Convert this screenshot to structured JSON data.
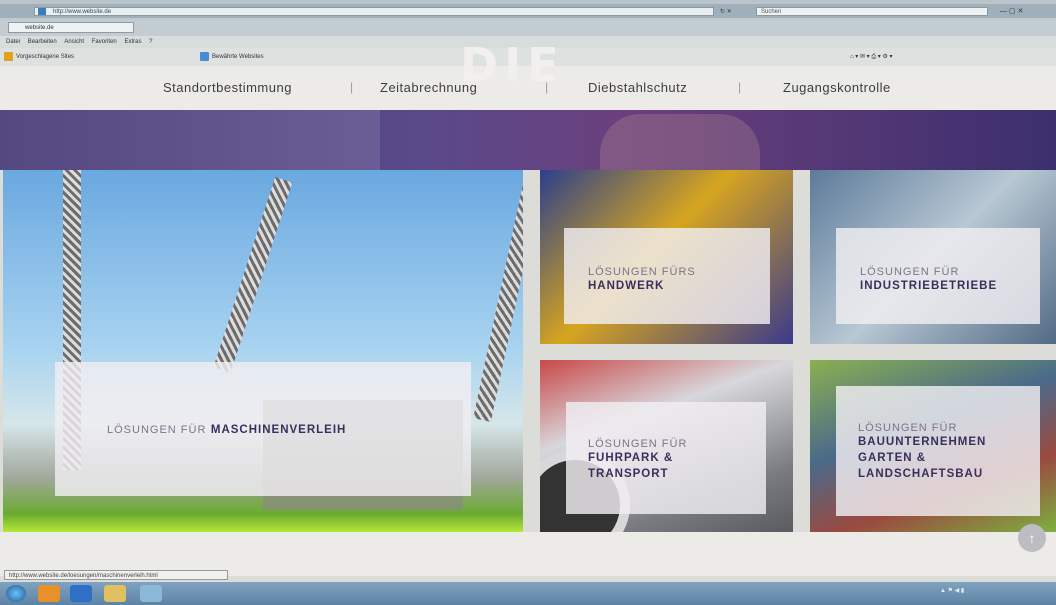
{
  "browser": {
    "url": "http://www.website.de",
    "search_placeholder": "Suchen",
    "tab_title": "website.de",
    "menu": [
      "Datei",
      "Bearbeiten",
      "Ansicht",
      "Favoriten",
      "Extras",
      "?"
    ],
    "favorites": [
      "Vorgeschlagene Sites",
      "Bewährte Websites"
    ]
  },
  "nav": {
    "items": [
      "Standortbestimmung",
      "Zeitabrechnung",
      "Diebstahlschutz",
      "Zugangskontrolle"
    ],
    "separator": "|"
  },
  "hero": {
    "partial_text": "DIE"
  },
  "tiles": {
    "maschinenverleih": {
      "prefix": "LÖSUNGEN FÜR",
      "title": "MASCHINENVERLEIH"
    },
    "handwerk": {
      "prefix": "LÖSUNGEN FÜRS",
      "title": "HANDWERK"
    },
    "industrie": {
      "prefix": "LÖSUNGEN FÜR",
      "title": "INDUSTRIEBETRIEBE"
    },
    "fuhrpark": {
      "prefix": "LÖSUNGEN FÜR",
      "title_line1": "FUHRPARK &",
      "title_line2": "TRANSPORT"
    },
    "bau": {
      "prefix": "LÖSUNGEN FÜR",
      "title_line1": "BAUUNTERNEHMEN",
      "title_line2": "GARTEN &",
      "title_line3": "LANDSCHAFTSBAU"
    }
  },
  "status_url": "http://www.website.de/loesungen/maschinenverleih.html",
  "scroll_top": "↑",
  "colors": {
    "accent": "#3a2f5c",
    "nav_bg": "#ecebe7",
    "hero": "#3c2f6e"
  }
}
